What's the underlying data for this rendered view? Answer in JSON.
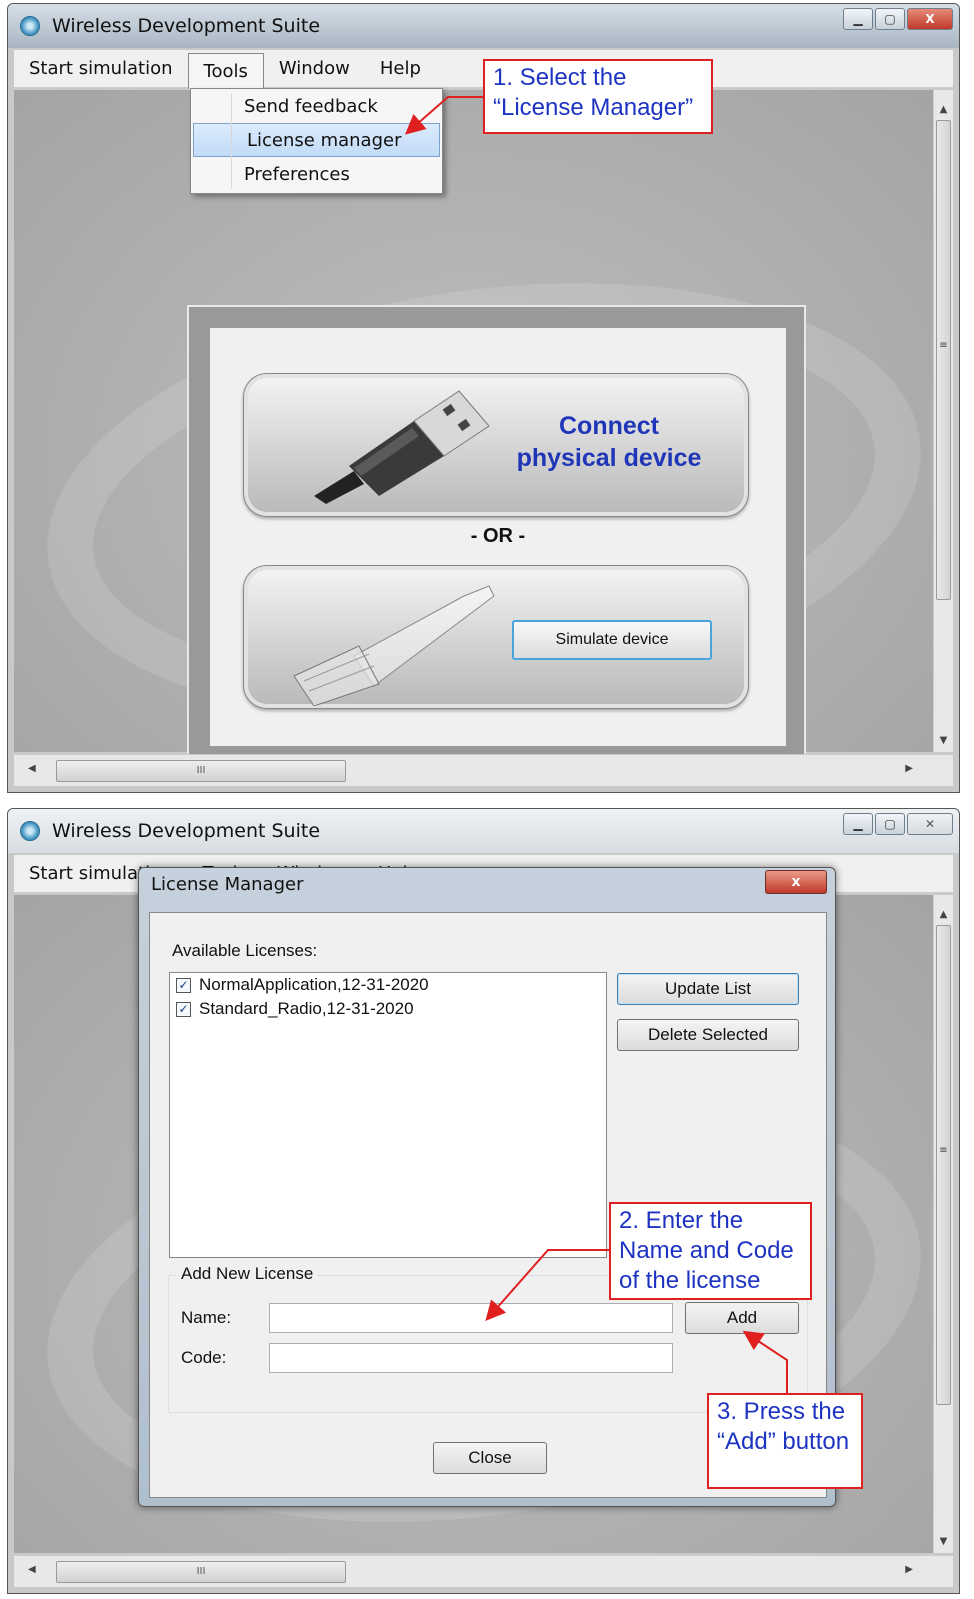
{
  "screen1": {
    "title": "Wireless Development Suite",
    "menu": [
      "Start simulation",
      "Tools",
      "Window",
      "Help"
    ],
    "tools_menu": [
      "Send feedback",
      "License manager",
      "Preferences"
    ],
    "connect_label_1": "Connect",
    "connect_label_2": "physical device",
    "or_label": "- OR -",
    "simulate_button": "Simulate device",
    "callout_1_line1": "1. Select the",
    "callout_1_line2": "“License Manager”",
    "hscroll_grip": "III"
  },
  "screen2": {
    "title": "Wireless Development Suite",
    "menu": [
      "Start simulation",
      "Tools",
      "Window",
      "Help"
    ],
    "dialog": {
      "title": "License Manager",
      "close_glyph": "x",
      "available_label": "Available Licenses:",
      "licenses": [
        {
          "name": "NormalApplication,12-31-2020",
          "checked": true
        },
        {
          "name": "Standard_Radio,12-31-2020",
          "checked": true
        }
      ],
      "update_button": "Update List",
      "delete_button": "Delete Selected",
      "add_group_label": "Add New License",
      "name_label": "Name:",
      "code_label": "Code:",
      "name_value": "",
      "code_value": "",
      "add_button": "Add",
      "close_button": "Close"
    },
    "callout_2_line1": "2. Enter the",
    "callout_2_line2": "Name and Code",
    "callout_2_line3": "of the license",
    "callout_3_line1": "3. Press the",
    "callout_3_line2": "“Add” button",
    "hscroll_grip": "III"
  },
  "colors": {
    "callout_border": "#e02020",
    "callout_text": "#1d33c2",
    "connect_text": "#1f36b8",
    "menu_highlight": "#c1dbf7"
  }
}
